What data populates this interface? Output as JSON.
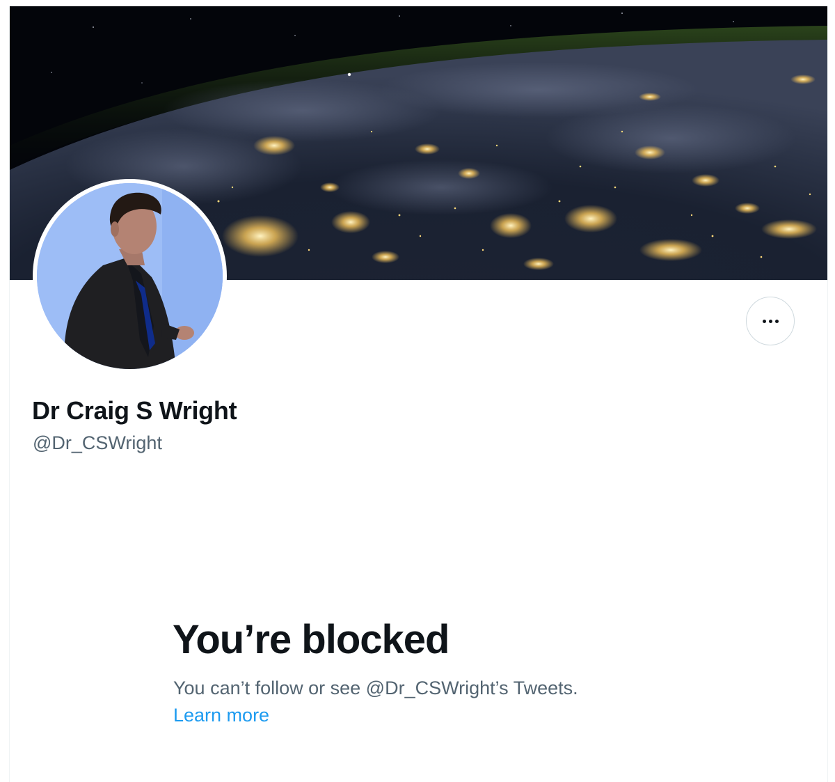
{
  "profile": {
    "display_name": "Dr Craig S Wright",
    "handle": "@Dr_CSWright"
  },
  "banner": {
    "icon": "earth-at-night-photo"
  },
  "avatar": {
    "icon": "profile-photo"
  },
  "actions": {
    "more_icon": "more-dots-icon"
  },
  "blocked": {
    "title": "You’re blocked",
    "message": "You can’t follow or see @Dr_CSWright’s Tweets.",
    "learn_more": "Learn more"
  },
  "colors": {
    "text_primary": "#0f1419",
    "text_secondary": "#536471",
    "link": "#1d9bf0",
    "border": "#cfd9de",
    "avatar_background": "#9bbcf5"
  }
}
